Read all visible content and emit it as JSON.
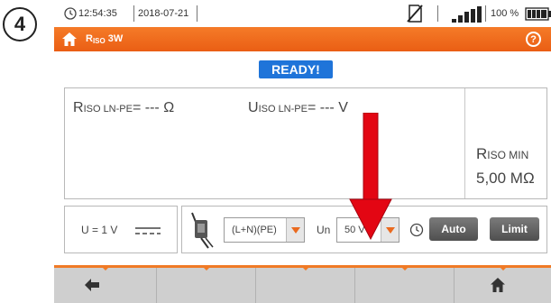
{
  "step_badge": "4",
  "status": {
    "time": "12:54:35",
    "date": "2018-07-21",
    "battery_percent": "100 %",
    "icons": [
      "clock-icon",
      "sd-card-icon",
      "signal-icon",
      "battery-icon",
      "plug-icon"
    ]
  },
  "header": {
    "title_main": "R",
    "title_sub": "ISO",
    "title_suffix": " 3W",
    "help": "?"
  },
  "state_badge": "READY!",
  "results": {
    "riso_sym": "R",
    "riso_sub": "ISO LN-PE",
    "riso_rest": "= --- Ω",
    "uiso_sym": "U",
    "uiso_sub": "ISO LN-PE",
    "uiso_rest": "= --- V",
    "rmin_sym": "R",
    "rmin_sub": "ISO MIN",
    "rmin_value": "5,00 MΩ"
  },
  "voltage_box": {
    "label": "U = 1 V"
  },
  "controls": {
    "config_value": "(L+N)(PE)",
    "un_label": "Un",
    "un_value": "50 V",
    "auto_label": "Auto",
    "limit_label": "Limit"
  },
  "colors": {
    "accent": "#ea6a1f",
    "ready_blue": "#1f74d9",
    "arrow_red": "#e30613"
  }
}
